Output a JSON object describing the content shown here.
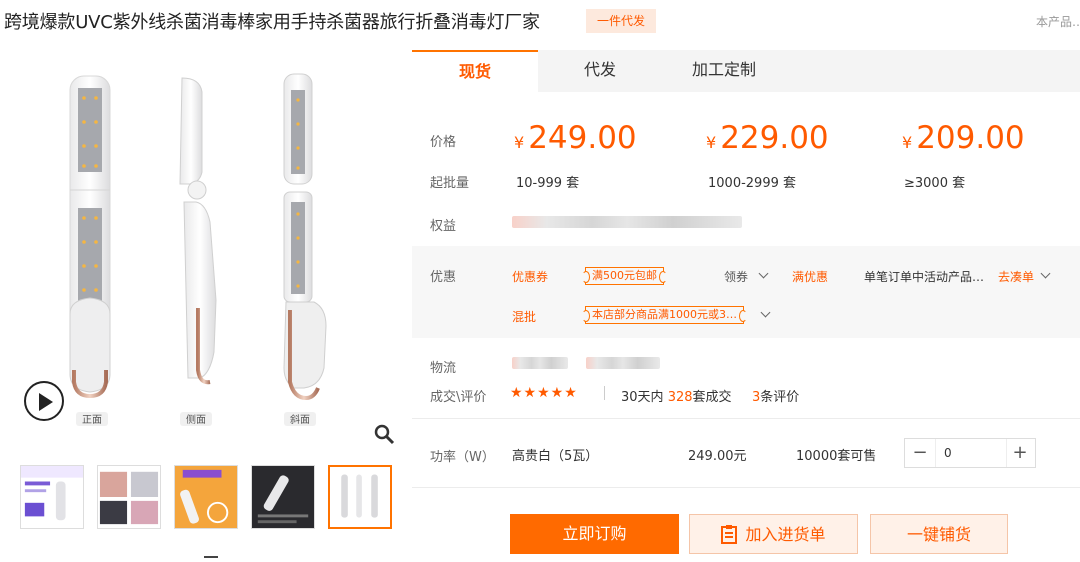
{
  "header": {
    "title": "跨境爆款UVC紫外线杀菌消毒棒家用手持杀菌器旅行折叠消毒灯厂家",
    "badge": "一件代发",
    "top_right": "本产品…"
  },
  "gallery": {
    "view_labels": [
      "正面",
      "侧面",
      "斜面"
    ],
    "thumbnail_count": 5,
    "active_thumbnail": 5
  },
  "tabs": [
    {
      "label": "现货",
      "active": true
    },
    {
      "label": "代发",
      "active": false
    },
    {
      "label": "加工定制",
      "active": false
    }
  ],
  "pricing": {
    "price_label": "价格",
    "moq_label": "起批量",
    "currency": "¥",
    "tiers": [
      {
        "price": "249.00",
        "moq": "10-999 套"
      },
      {
        "price": "229.00",
        "moq": "1000-2999 套"
      },
      {
        "price": "209.00",
        "moq": "≥3000 套"
      }
    ],
    "rights_label": "权益"
  },
  "promo": {
    "label": "优惠",
    "coupon_link": "优惠券",
    "coupon_tag": "满500元包邮",
    "claim_label": "领券",
    "full_discount_link": "满优惠",
    "activity_text": "单笔订单中活动产品…",
    "go_link": "去凑单",
    "mixed_link": "混批",
    "mixed_tag": "本店部分商品满1000元或3…"
  },
  "logistics": {
    "label": "物流",
    "review_label": "成交\\评价",
    "rating": 5,
    "stars_text": "★★★★★",
    "deals_prefix": "30天内",
    "deals_count": "328",
    "deals_suffix": "套成交",
    "review_count": "3",
    "review_suffix": "条评价"
  },
  "sku": {
    "label": "功率（W）",
    "name": "高贵白（5瓦）",
    "price": "249.00元",
    "stock": "10000套可售",
    "quantity": "0",
    "minus": "−",
    "plus": "+"
  },
  "actions": {
    "buy": "立即订购",
    "cart": "加入进货单",
    "list": "一键铺货"
  },
  "colors": {
    "accent": "#ff6a00",
    "accent_text": "#ff5a00",
    "light_accent_bg": "#fff1e8"
  }
}
